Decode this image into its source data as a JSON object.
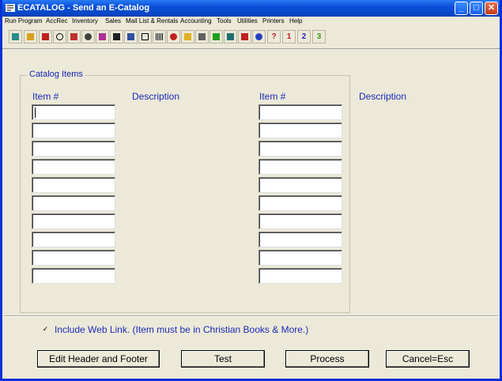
{
  "window": {
    "title": "ECATALOG - Send an E-Catalog",
    "min": "_",
    "max": "□",
    "close": "✕"
  },
  "menu": [
    "Run Program",
    "AccRec",
    "Inventory",
    "Sales",
    "Mail List & Rentals",
    "Accounting",
    "Tools",
    "Utilities",
    "Printers",
    "Help"
  ],
  "toolbar": {
    "one": "1",
    "two": "2",
    "three": "3",
    "help": "?"
  },
  "group_title": "Catalog Items",
  "columns": {
    "item_left": "Item #",
    "desc_left": "Description",
    "item_right": "Item #",
    "desc_right": "Description"
  },
  "include_web_link": {
    "checked": true,
    "mark": "✓",
    "label": "Include Web Link. (Item must be in Christian Books & More.)"
  },
  "buttons": {
    "edit": "Edit Header and Footer",
    "test": "Test",
    "process": "Process",
    "cancel": "Cancel=Esc"
  },
  "accent": "#1c2ab8"
}
